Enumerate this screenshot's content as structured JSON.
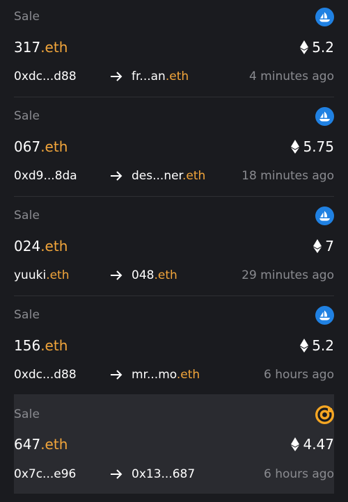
{
  "activity": [
    {
      "type": "Sale",
      "name": "317",
      "suffix": ".eth",
      "price": "5.2",
      "from": {
        "name": "0xdc...d88",
        "suffix": ""
      },
      "to": {
        "name": "fr...an",
        "suffix": ".eth"
      },
      "time": "4 minutes ago",
      "marketplace_icon": "opensea-icon"
    },
    {
      "type": "Sale",
      "name": "067",
      "suffix": ".eth",
      "price": "5.75",
      "from": {
        "name": "0xd9...8da",
        "suffix": ""
      },
      "to": {
        "name": "des...ner",
        "suffix": ".eth"
      },
      "time": "18 minutes ago",
      "marketplace_icon": "opensea-icon"
    },
    {
      "type": "Sale",
      "name": "024",
      "suffix": ".eth",
      "price": "7",
      "from": {
        "name": "yuuki",
        "suffix": ".eth"
      },
      "to": {
        "name": "048",
        "suffix": ".eth"
      },
      "time": "29 minutes ago",
      "marketplace_icon": "opensea-icon"
    },
    {
      "type": "Sale",
      "name": "156",
      "suffix": ".eth",
      "price": "5.2",
      "from": {
        "name": "0xdc...d88",
        "suffix": ""
      },
      "to": {
        "name": "mr...mo",
        "suffix": ".eth"
      },
      "time": "6 hours ago",
      "marketplace_icon": "opensea-icon"
    },
    {
      "type": "Sale",
      "name": "647",
      "suffix": ".eth",
      "price": "4.47",
      "from": {
        "name": "0x7c...e96",
        "suffix": ""
      },
      "to": {
        "name": "0x13...687",
        "suffix": ""
      },
      "time": "6 hours ago",
      "marketplace_icon": "x2y2-icon"
    }
  ],
  "colors": {
    "background": "#1a1b1f",
    "highlight_row": "#2a2b30",
    "muted_text": "#8a8b90",
    "eth_suffix": "#f3a63b",
    "opensea_blue": "#2081e2",
    "x2y2_orange": "#f5a623"
  }
}
